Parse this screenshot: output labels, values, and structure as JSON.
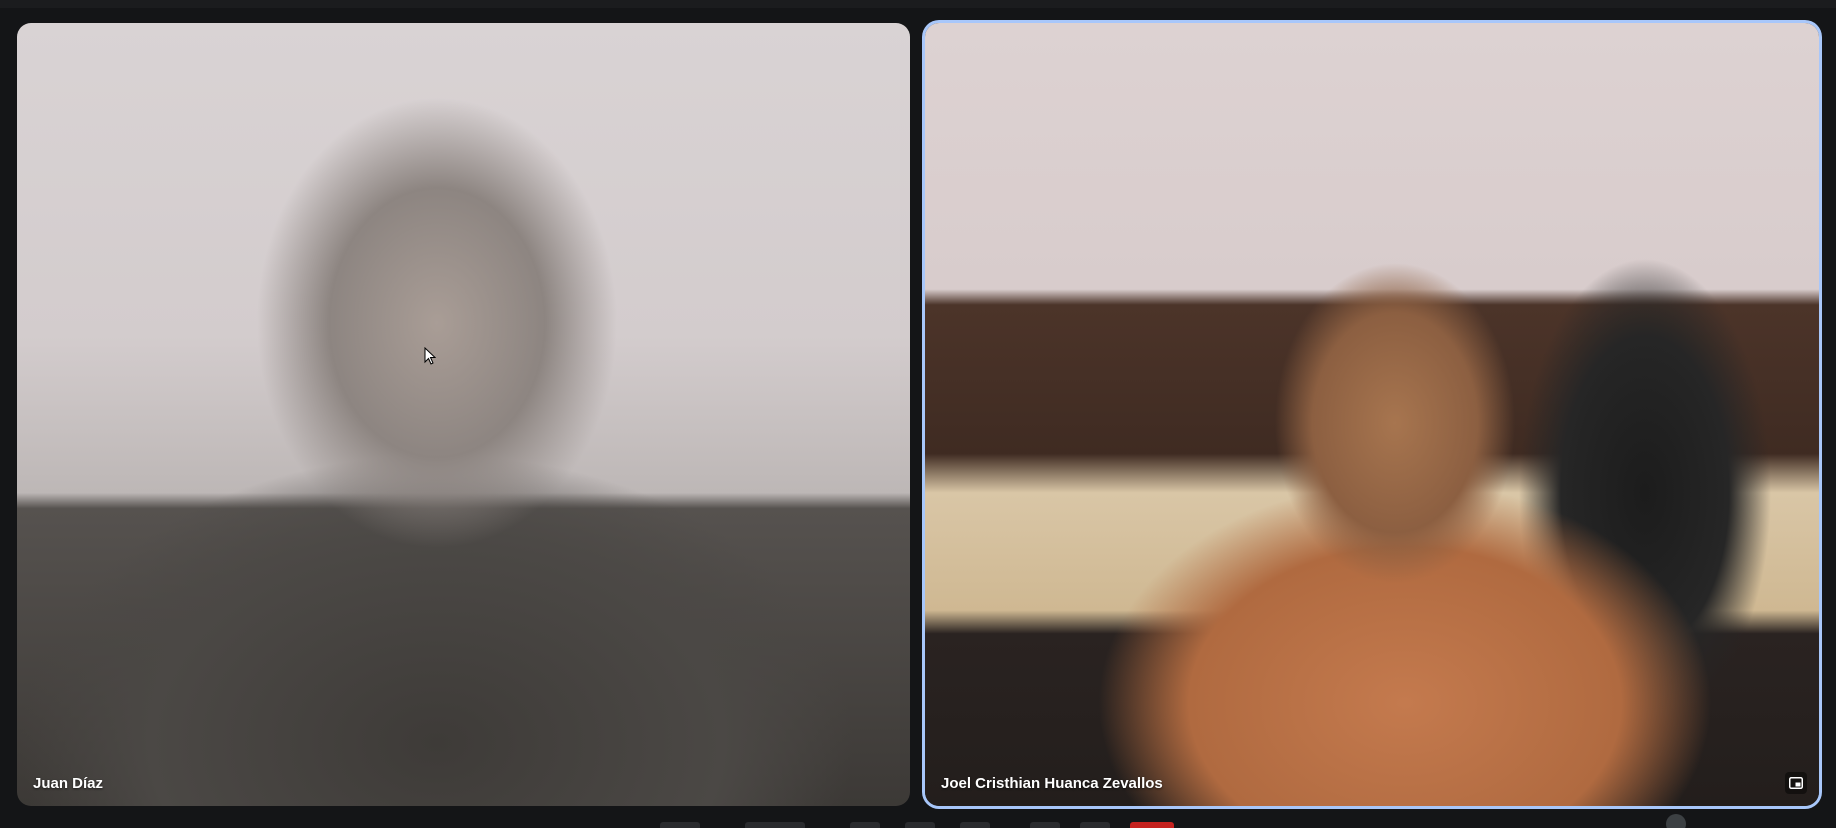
{
  "participants": [
    {
      "name": "Juan Díaz",
      "camera": "on"
    },
    {
      "name": "Joel Cristhian Huanca Zevallos",
      "camera": "on",
      "highlighted": true
    }
  ],
  "colors": {
    "background": "#141517",
    "active_speaker_border": "#a8c7fa",
    "name_text": "#ffffff",
    "hangup_red": "#c5221f"
  },
  "icons": {
    "cursor": "mouse-pointer-icon",
    "tile_action": "picture-in-picture-icon"
  }
}
